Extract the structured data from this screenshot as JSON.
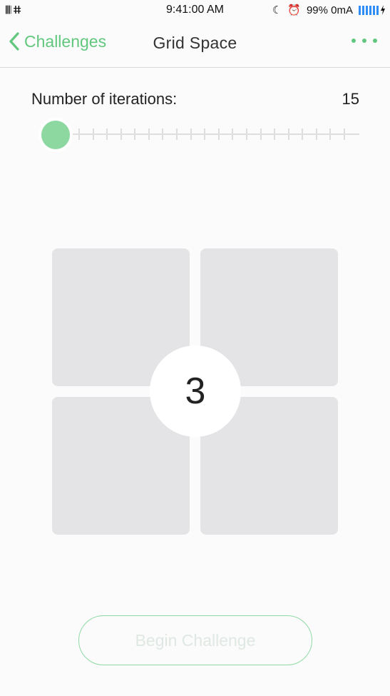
{
  "status_bar": {
    "left_text": "𝄃𝄃𝄃 ⵌ",
    "time": "9:41:00 AM",
    "battery": "99% 0mA"
  },
  "nav": {
    "back_label": "Challenges",
    "title": "Grid Space"
  },
  "slider": {
    "label": "Number of iterations:",
    "value": "15",
    "fraction": 0.0,
    "tick_count": 20
  },
  "grid": {
    "counter": "3"
  },
  "footer": {
    "begin_label": "Begin Challenge"
  },
  "colors": {
    "accent": "#62c77e",
    "thumb": "#8cd8a0",
    "cell": "#e4e4e6",
    "battery": "#2f8df5"
  }
}
